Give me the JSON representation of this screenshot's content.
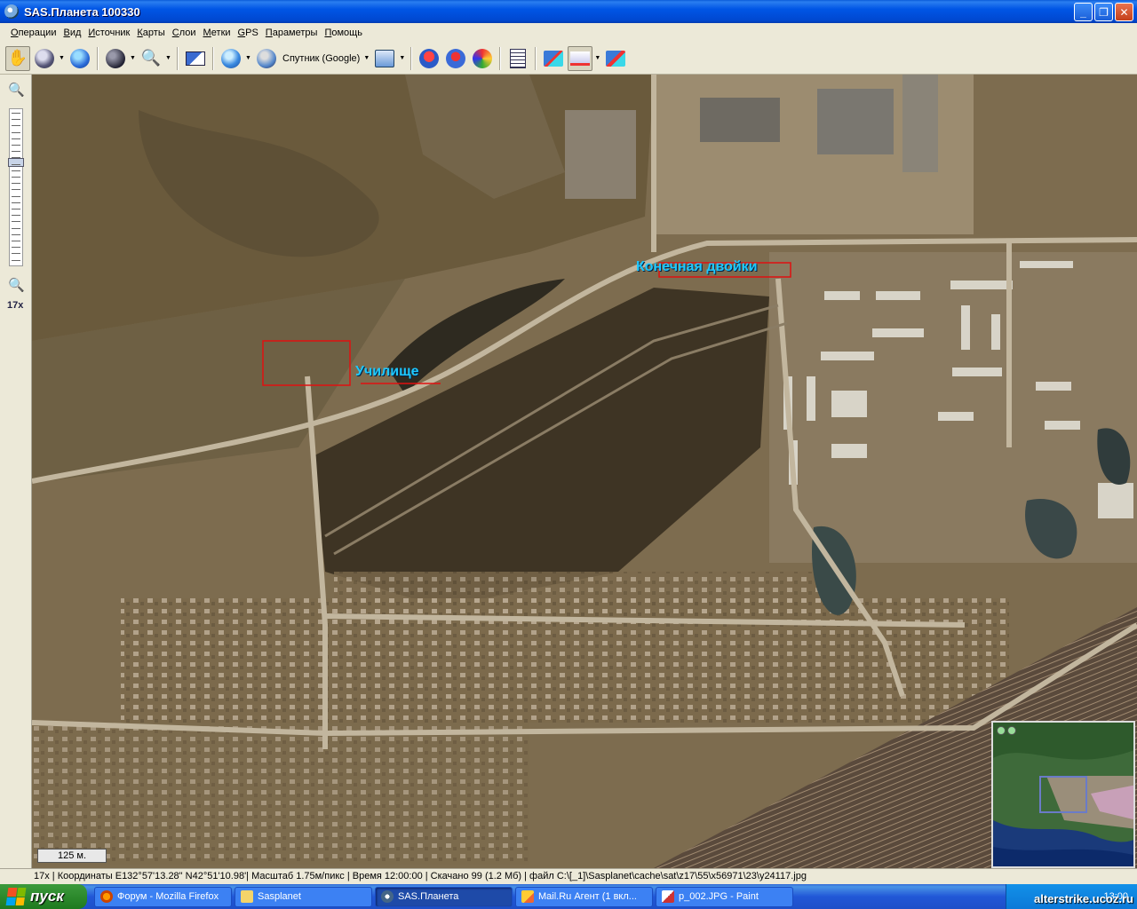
{
  "window": {
    "title": "SAS.Планета 100330"
  },
  "menu": [
    "Операции",
    "Вид",
    "Источник",
    "Карты",
    "Слои",
    "Метки",
    "GPS",
    "Параметры",
    "Помощь"
  ],
  "toolbar": {
    "source_label": "Спутник (Google)"
  },
  "zoom": {
    "level_label": "17x",
    "level_fraction": 0.33
  },
  "map": {
    "labels": {
      "terminal": "Конечная двойки",
      "school": "Училище"
    },
    "scale": "125 м."
  },
  "status": "17x | Координаты E132°57'13.28\" N42°51'10.98'| Масштаб 1.75м/пикс | Время 12:00:00 | Скачано 99 (1.2 Мб) | файл C:\\[_1]\\Sasplanet\\cache\\sat\\z17\\55\\x56971\\23\\y24117.jpg",
  "taskbar": {
    "start_label": "пуск",
    "items": [
      {
        "label": "Форум - Mozilla Firefox"
      },
      {
        "label": "Sasplanet"
      },
      {
        "label": "SAS.Планета"
      },
      {
        "label": "Mail.Ru Агент (1 вкл..."
      },
      {
        "label": "p_002.JPG - Paint"
      }
    ],
    "clock": "13:00"
  },
  "watermark": "alterstrike.ucoz.ru",
  "colors": {
    "accent": "#0055e5",
    "map_label": "#1ec8ff",
    "highlight_box": "#e01010"
  }
}
